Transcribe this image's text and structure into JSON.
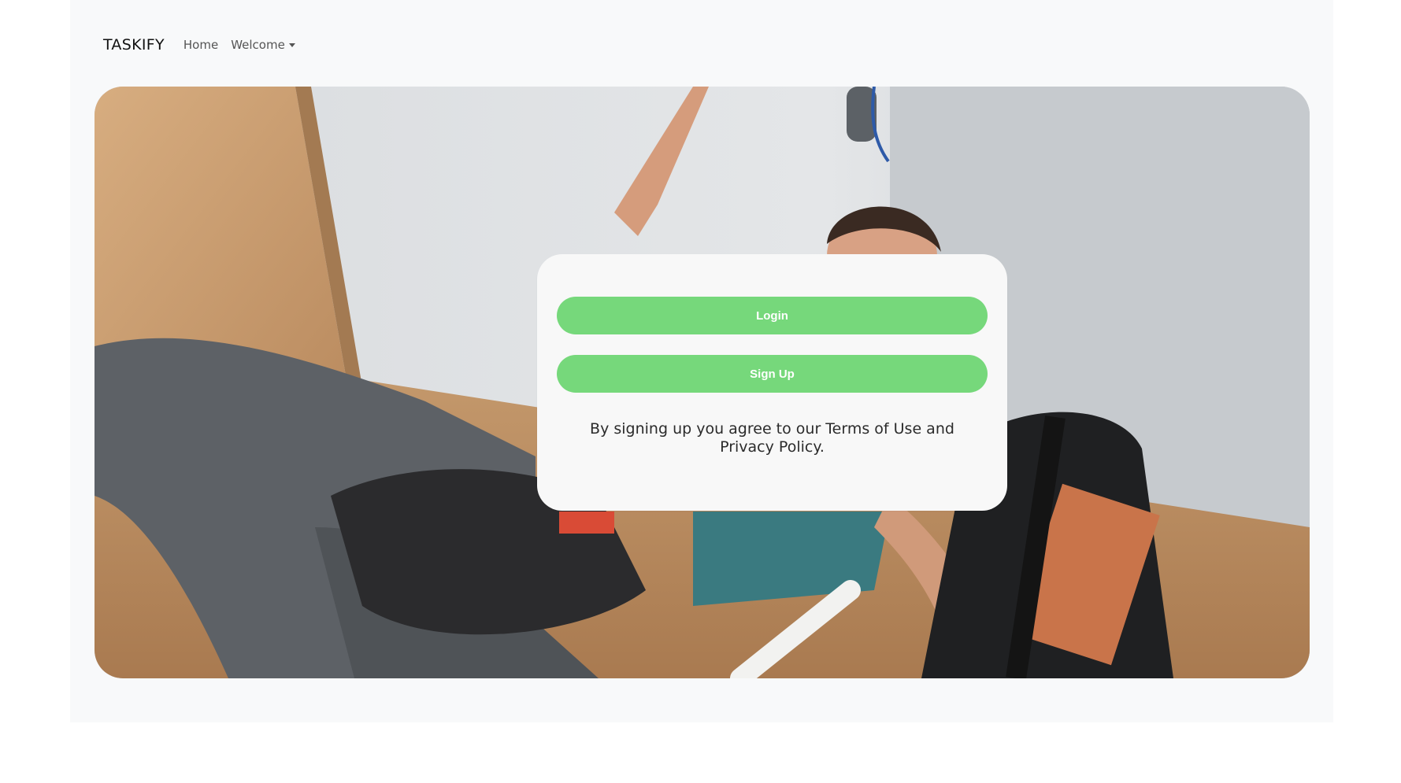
{
  "navbar": {
    "brand": "TASKIFY",
    "links": [
      {
        "label": "Home"
      },
      {
        "label": "Welcome",
        "has_dropdown": true
      }
    ]
  },
  "hero": {
    "image": "photo: plumber lying on floor working under a sink with a tool bag"
  },
  "auth_card": {
    "login_label": "Login",
    "signup_label": "Sign Up",
    "terms_text": "By signing up you agree to our Terms of Use and Privacy Policy."
  },
  "colors": {
    "page_background": "#f8f9fa",
    "button": "#76d87b",
    "card": "#f8f8f8"
  }
}
